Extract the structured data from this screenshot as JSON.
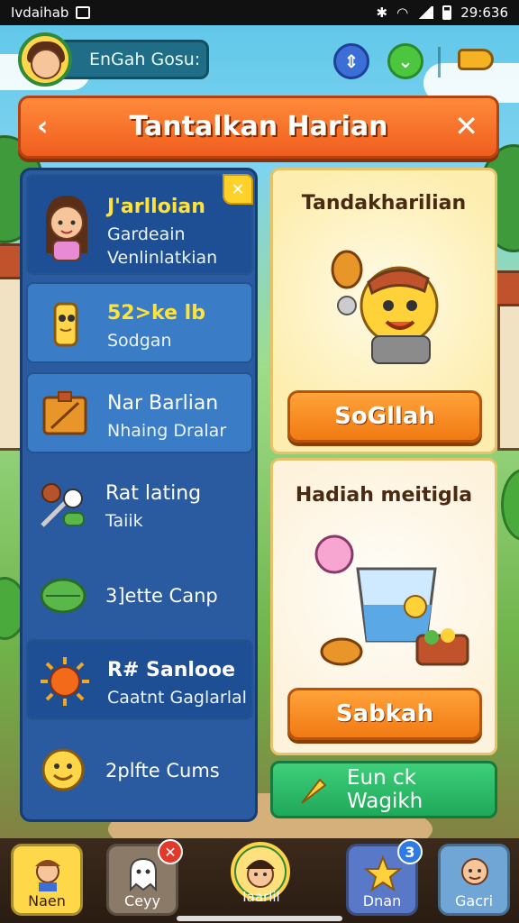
{
  "status_bar": {
    "carrier": "Ivdaihab",
    "time": "29:636"
  },
  "profile": {
    "name": "EnGah Gosu:"
  },
  "banner": {
    "title": "Tantalkan Harian",
    "back_icon": "chevron-left-icon",
    "close_icon": "close-icon"
  },
  "tasks": [
    {
      "title": "J'arlloian",
      "subtitle1": "Gardeain",
      "subtitle2": "Venlinlatkian",
      "icon": "girl-character-icon"
    },
    {
      "title": "52>ke lb",
      "subtitle": "Sodgan",
      "icon": "scroll-icon"
    },
    {
      "title": "Nar Barlian",
      "subtitle": "Nhaing Dralar",
      "icon": "crate-icon"
    },
    {
      "title": "Rat lating",
      "subtitle": "Taiik",
      "icon": "cooking-tools-icon"
    },
    {
      "title": "3]ette Canp",
      "icon": "leaf-icon"
    },
    {
      "title": "R# Sanlooe",
      "subtitle": "Caatnt Gaglarlal",
      "icon": "sun-icon"
    },
    {
      "title": "2plfte Cums",
      "icon": "smiley-icon"
    }
  ],
  "cards": {
    "daily": {
      "title": "Tandakharilian",
      "button": "SoGllah"
    },
    "reward": {
      "title": "Hadiah meitigla",
      "button": "Sabkah"
    }
  },
  "green_button": {
    "label": "Eun ck Wagikh"
  },
  "bottom_nav": {
    "items": [
      {
        "label": "Naen",
        "icon": "character-icon"
      },
      {
        "label": "Ceyy",
        "icon": "ghost-icon",
        "badge": "✕"
      },
      {
        "label": "Iaarlil",
        "icon": "avatar-icon"
      },
      {
        "label": "Dnan",
        "icon": "star-map-icon",
        "badge": "3"
      },
      {
        "label": "Gacri",
        "icon": "friend-icon"
      }
    ]
  }
}
